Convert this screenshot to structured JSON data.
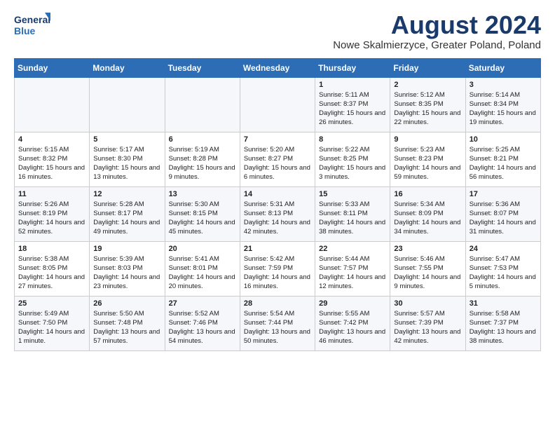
{
  "header": {
    "logo_line1": "General",
    "logo_line2": "Blue",
    "title": "August 2024",
    "subtitle": "Nowe Skalmierzyce, Greater Poland, Poland"
  },
  "columns": [
    "Sunday",
    "Monday",
    "Tuesday",
    "Wednesday",
    "Thursday",
    "Friday",
    "Saturday"
  ],
  "weeks": [
    [
      {
        "day": "",
        "sunrise": "",
        "sunset": "",
        "daylight": ""
      },
      {
        "day": "",
        "sunrise": "",
        "sunset": "",
        "daylight": ""
      },
      {
        "day": "",
        "sunrise": "",
        "sunset": "",
        "daylight": ""
      },
      {
        "day": "",
        "sunrise": "",
        "sunset": "",
        "daylight": ""
      },
      {
        "day": "1",
        "sunrise": "Sunrise: 5:11 AM",
        "sunset": "Sunset: 8:37 PM",
        "daylight": "Daylight: 15 hours and 26 minutes."
      },
      {
        "day": "2",
        "sunrise": "Sunrise: 5:12 AM",
        "sunset": "Sunset: 8:35 PM",
        "daylight": "Daylight: 15 hours and 22 minutes."
      },
      {
        "day": "3",
        "sunrise": "Sunrise: 5:14 AM",
        "sunset": "Sunset: 8:34 PM",
        "daylight": "Daylight: 15 hours and 19 minutes."
      }
    ],
    [
      {
        "day": "4",
        "sunrise": "Sunrise: 5:15 AM",
        "sunset": "Sunset: 8:32 PM",
        "daylight": "Daylight: 15 hours and 16 minutes."
      },
      {
        "day": "5",
        "sunrise": "Sunrise: 5:17 AM",
        "sunset": "Sunset: 8:30 PM",
        "daylight": "Daylight: 15 hours and 13 minutes."
      },
      {
        "day": "6",
        "sunrise": "Sunrise: 5:19 AM",
        "sunset": "Sunset: 8:28 PM",
        "daylight": "Daylight: 15 hours and 9 minutes."
      },
      {
        "day": "7",
        "sunrise": "Sunrise: 5:20 AM",
        "sunset": "Sunset: 8:27 PM",
        "daylight": "Daylight: 15 hours and 6 minutes."
      },
      {
        "day": "8",
        "sunrise": "Sunrise: 5:22 AM",
        "sunset": "Sunset: 8:25 PM",
        "daylight": "Daylight: 15 hours and 3 minutes."
      },
      {
        "day": "9",
        "sunrise": "Sunrise: 5:23 AM",
        "sunset": "Sunset: 8:23 PM",
        "daylight": "Daylight: 14 hours and 59 minutes."
      },
      {
        "day": "10",
        "sunrise": "Sunrise: 5:25 AM",
        "sunset": "Sunset: 8:21 PM",
        "daylight": "Daylight: 14 hours and 56 minutes."
      }
    ],
    [
      {
        "day": "11",
        "sunrise": "Sunrise: 5:26 AM",
        "sunset": "Sunset: 8:19 PM",
        "daylight": "Daylight: 14 hours and 52 minutes."
      },
      {
        "day": "12",
        "sunrise": "Sunrise: 5:28 AM",
        "sunset": "Sunset: 8:17 PM",
        "daylight": "Daylight: 14 hours and 49 minutes."
      },
      {
        "day": "13",
        "sunrise": "Sunrise: 5:30 AM",
        "sunset": "Sunset: 8:15 PM",
        "daylight": "Daylight: 14 hours and 45 minutes."
      },
      {
        "day": "14",
        "sunrise": "Sunrise: 5:31 AM",
        "sunset": "Sunset: 8:13 PM",
        "daylight": "Daylight: 14 hours and 42 minutes."
      },
      {
        "day": "15",
        "sunrise": "Sunrise: 5:33 AM",
        "sunset": "Sunset: 8:11 PM",
        "daylight": "Daylight: 14 hours and 38 minutes."
      },
      {
        "day": "16",
        "sunrise": "Sunrise: 5:34 AM",
        "sunset": "Sunset: 8:09 PM",
        "daylight": "Daylight: 14 hours and 34 minutes."
      },
      {
        "day": "17",
        "sunrise": "Sunrise: 5:36 AM",
        "sunset": "Sunset: 8:07 PM",
        "daylight": "Daylight: 14 hours and 31 minutes."
      }
    ],
    [
      {
        "day": "18",
        "sunrise": "Sunrise: 5:38 AM",
        "sunset": "Sunset: 8:05 PM",
        "daylight": "Daylight: 14 hours and 27 minutes."
      },
      {
        "day": "19",
        "sunrise": "Sunrise: 5:39 AM",
        "sunset": "Sunset: 8:03 PM",
        "daylight": "Daylight: 14 hours and 23 minutes."
      },
      {
        "day": "20",
        "sunrise": "Sunrise: 5:41 AM",
        "sunset": "Sunset: 8:01 PM",
        "daylight": "Daylight: 14 hours and 20 minutes."
      },
      {
        "day": "21",
        "sunrise": "Sunrise: 5:42 AM",
        "sunset": "Sunset: 7:59 PM",
        "daylight": "Daylight: 14 hours and 16 minutes."
      },
      {
        "day": "22",
        "sunrise": "Sunrise: 5:44 AM",
        "sunset": "Sunset: 7:57 PM",
        "daylight": "Daylight: 14 hours and 12 minutes."
      },
      {
        "day": "23",
        "sunrise": "Sunrise: 5:46 AM",
        "sunset": "Sunset: 7:55 PM",
        "daylight": "Daylight: 14 hours and 9 minutes."
      },
      {
        "day": "24",
        "sunrise": "Sunrise: 5:47 AM",
        "sunset": "Sunset: 7:53 PM",
        "daylight": "Daylight: 14 hours and 5 minutes."
      }
    ],
    [
      {
        "day": "25",
        "sunrise": "Sunrise: 5:49 AM",
        "sunset": "Sunset: 7:50 PM",
        "daylight": "Daylight: 14 hours and 1 minute."
      },
      {
        "day": "26",
        "sunrise": "Sunrise: 5:50 AM",
        "sunset": "Sunset: 7:48 PM",
        "daylight": "Daylight: 13 hours and 57 minutes."
      },
      {
        "day": "27",
        "sunrise": "Sunrise: 5:52 AM",
        "sunset": "Sunset: 7:46 PM",
        "daylight": "Daylight: 13 hours and 54 minutes."
      },
      {
        "day": "28",
        "sunrise": "Sunrise: 5:54 AM",
        "sunset": "Sunset: 7:44 PM",
        "daylight": "Daylight: 13 hours and 50 minutes."
      },
      {
        "day": "29",
        "sunrise": "Sunrise: 5:55 AM",
        "sunset": "Sunset: 7:42 PM",
        "daylight": "Daylight: 13 hours and 46 minutes."
      },
      {
        "day": "30",
        "sunrise": "Sunrise: 5:57 AM",
        "sunset": "Sunset: 7:39 PM",
        "daylight": "Daylight: 13 hours and 42 minutes."
      },
      {
        "day": "31",
        "sunrise": "Sunrise: 5:58 AM",
        "sunset": "Sunset: 7:37 PM",
        "daylight": "Daylight: 13 hours and 38 minutes."
      }
    ]
  ]
}
